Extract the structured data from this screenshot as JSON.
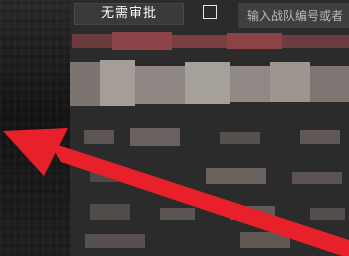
{
  "toolbar": {
    "approval_label": "无需审批",
    "approval_checked": false,
    "search_placeholder": "输入战队编号或者"
  },
  "colors": {
    "arrow": "#e8202a",
    "panel": "#2b2b2b",
    "button_bg": "#3a3a3a",
    "input_bg": "#3f3f3f"
  }
}
